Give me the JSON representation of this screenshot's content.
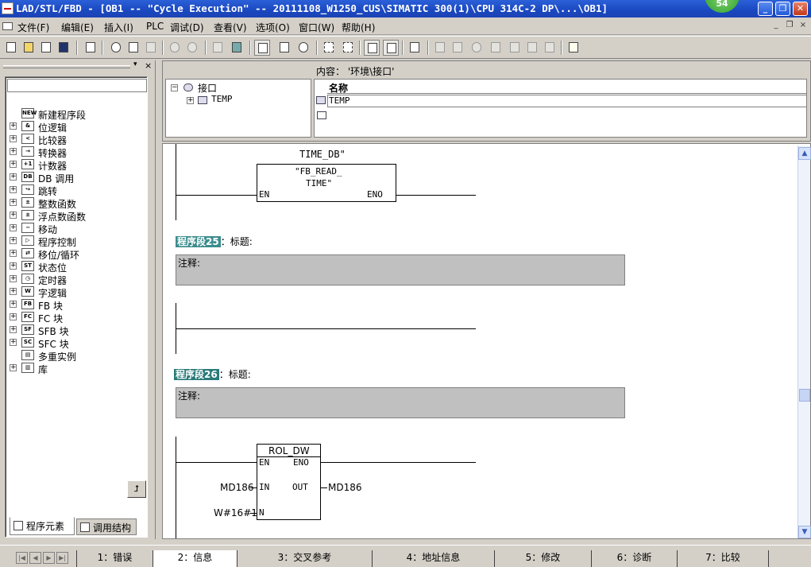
{
  "titlebar": {
    "title": "LAD/STL/FBD  - [OB1 -- \"Cycle Execution\" -- 20111108_W1250_CUS\\SIMATIC 300(1)\\CPU 314C-2 DP\\...\\OB1]",
    "badge": "54",
    "minimize": "_",
    "restore": "❐",
    "close": "✕"
  },
  "menu": {
    "items": [
      "文件(F)",
      "编辑(E)",
      "插入(I)",
      "PLC",
      "调试(D)",
      "查看(V)",
      "选项(O)",
      "窗口(W)",
      "帮助(H)"
    ],
    "mdi_min": "_",
    "mdi_restore": "❐",
    "mdi_close": "×"
  },
  "toolbar": {
    "icons": [
      "new-icon",
      "open-icon",
      "accessible-nodes-icon",
      "save-icon",
      "print-icon",
      "cut-icon",
      "copy-icon",
      "paste-icon",
      "undo-icon",
      "redo-icon",
      "load-icon",
      "monitor-icon",
      "overview-icon",
      "program-elements-icon",
      "network-icon",
      "insert-network-icon",
      "toggle-icon",
      "details-icon",
      "display-icon",
      "ladder-icon",
      "contact-no-icon",
      "contact-nc-icon",
      "coil-icon",
      "empty-box-icon",
      "open-branch-icon",
      "close-branch-icon",
      "connection-icon",
      "help-icon"
    ]
  },
  "left_panel": {
    "tree": [
      {
        "label": "新建程序段",
        "icon": "NEW",
        "expandable": false
      },
      {
        "label": "位逻辑",
        "icon": "&",
        "expandable": true
      },
      {
        "label": "比较器",
        "icon": "<",
        "expandable": true
      },
      {
        "label": "转换器",
        "icon": "→",
        "expandable": true
      },
      {
        "label": "计数器",
        "icon": "+1",
        "expandable": true
      },
      {
        "label": "DB 调用",
        "icon": "DB",
        "expandable": true
      },
      {
        "label": "跳转",
        "icon": "↪",
        "expandable": true
      },
      {
        "label": "整数函数",
        "icon": "±",
        "expandable": true
      },
      {
        "label": "浮点数函数",
        "icon": "±",
        "expandable": true
      },
      {
        "label": "移动",
        "icon": "~",
        "expandable": true
      },
      {
        "label": "程序控制",
        "icon": "▷",
        "expandable": true
      },
      {
        "label": "移位/循环",
        "icon": "⇄",
        "expandable": true
      },
      {
        "label": "状态位",
        "icon": "ST",
        "expandable": true
      },
      {
        "label": "定时器",
        "icon": "◷",
        "expandable": true
      },
      {
        "label": "字逻辑",
        "icon": "W",
        "expandable": true
      },
      {
        "label": "FB 块",
        "icon": "FB",
        "expandable": true
      },
      {
        "label": "FC 块",
        "icon": "FC",
        "expandable": true
      },
      {
        "label": "SFB 块",
        "icon": "SF",
        "expandable": true
      },
      {
        "label": "SFC 块",
        "icon": "SC",
        "expandable": true
      },
      {
        "label": "多重实例",
        "icon": "▤",
        "expandable": false
      },
      {
        "label": "库",
        "icon": "▥",
        "expandable": true
      }
    ],
    "tabs": [
      "程序元素",
      "调用结构"
    ]
  },
  "interface": {
    "tree": [
      {
        "label": "接口",
        "expanded": true
      },
      {
        "label": "TEMP",
        "expanded": false
      }
    ],
    "content_label": "内容：  '环境\\接口'",
    "column_header": "名称",
    "rows": [
      "TEMP"
    ]
  },
  "editor": {
    "network_prev": {
      "db_label": "TIME_DB\"",
      "fb_name_1": "\"FB_READ_",
      "fb_name_2": "TIME\"",
      "en": "EN",
      "eno": "ENO"
    },
    "network_25": {
      "number": "程序段25",
      "title_label": "：标题:",
      "comment": "注释:"
    },
    "network_26": {
      "number": "程序段26",
      "title_label": "：标题:",
      "comment": "注释:"
    },
    "network_27": {
      "block": "ROL_DW",
      "en": "EN",
      "eno": "ENO",
      "in": "IN",
      "out": "OUT",
      "n": "N",
      "in_operand": "MD186",
      "out_operand": "MD186",
      "n_operand": "W#16#1"
    }
  },
  "bottom_tabs": [
    "1：错误",
    "2：信息",
    "3：交叉参考",
    "4：地址信息",
    "5：修改",
    "6：诊断",
    "7：比较"
  ],
  "bottom_active_tab": "2：信息"
}
